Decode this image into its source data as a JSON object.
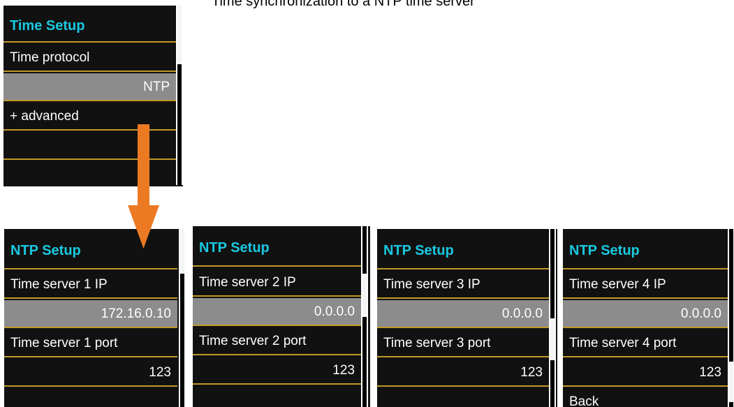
{
  "caption": "Time synchronization to a NTP time server",
  "time_setup": {
    "title": "Time Setup",
    "rows": [
      "Time protocol",
      "NTP",
      "+ advanced",
      "",
      ""
    ]
  },
  "ntp_screens": [
    {
      "title": "NTP Setup",
      "ip_label": "Time server 1 IP",
      "ip_value": "172.16.0.10",
      "port_label": "Time server 1 port",
      "port_value": "123",
      "last": ""
    },
    {
      "title": "NTP Setup",
      "ip_label": "Time server 2 IP",
      "ip_value": "0.0.0.0",
      "port_label": "Time server 2 port",
      "port_value": "123",
      "last": ""
    },
    {
      "title": "NTP Setup",
      "ip_label": "Time server 3 IP",
      "ip_value": "0.0.0.0",
      "port_label": "Time server 3 port",
      "port_value": "123",
      "last": ""
    },
    {
      "title": "NTP Setup",
      "ip_label": "Time server 4 IP",
      "ip_value": "0.0.0.0",
      "port_label": "Time server 4 port",
      "port_value": "123",
      "last": "Back"
    }
  ],
  "colors": {
    "title": "#19c9e0",
    "separator": "#c29a2a",
    "selected_row": "#8c8c8c",
    "arrow": "#ec7a22"
  },
  "icons": {
    "arrow": "down-arrow-icon"
  }
}
